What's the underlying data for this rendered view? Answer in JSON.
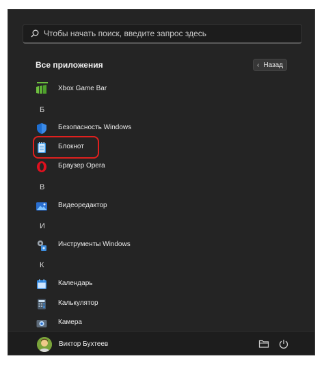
{
  "search": {
    "placeholder": "Чтобы начать поиск, введите запрос здесь"
  },
  "header": {
    "title": "Все приложения",
    "back_label": "Назад"
  },
  "apps": [
    {
      "label": "Xbox Game Bar",
      "icon": "xbox-game-bar-icon"
    },
    {
      "letter": "Б"
    },
    {
      "label": "Безопасность Windows",
      "icon": "windows-security-icon"
    },
    {
      "label": "Блокнот",
      "icon": "notepad-icon",
      "highlighted": true
    },
    {
      "label": "Браузер Opera",
      "icon": "opera-icon"
    },
    {
      "letter": "В"
    },
    {
      "label": "Видеоредактор",
      "icon": "video-editor-icon"
    },
    {
      "letter": "И"
    },
    {
      "label": "Инструменты Windows",
      "icon": "windows-tools-icon"
    },
    {
      "letter": "К"
    },
    {
      "label": "Календарь",
      "icon": "calendar-icon"
    },
    {
      "label": "Калькулятор",
      "icon": "calculator-icon"
    },
    {
      "label": "Камера",
      "icon": "camera-icon"
    }
  ],
  "footer": {
    "user_name": "Виктор Бухтеев",
    "explorer_icon": "folder-icon",
    "power_icon": "power-icon"
  },
  "colors": {
    "highlight": "#e0201e",
    "background": "#242424",
    "accent_green": "#6dbf3f"
  }
}
